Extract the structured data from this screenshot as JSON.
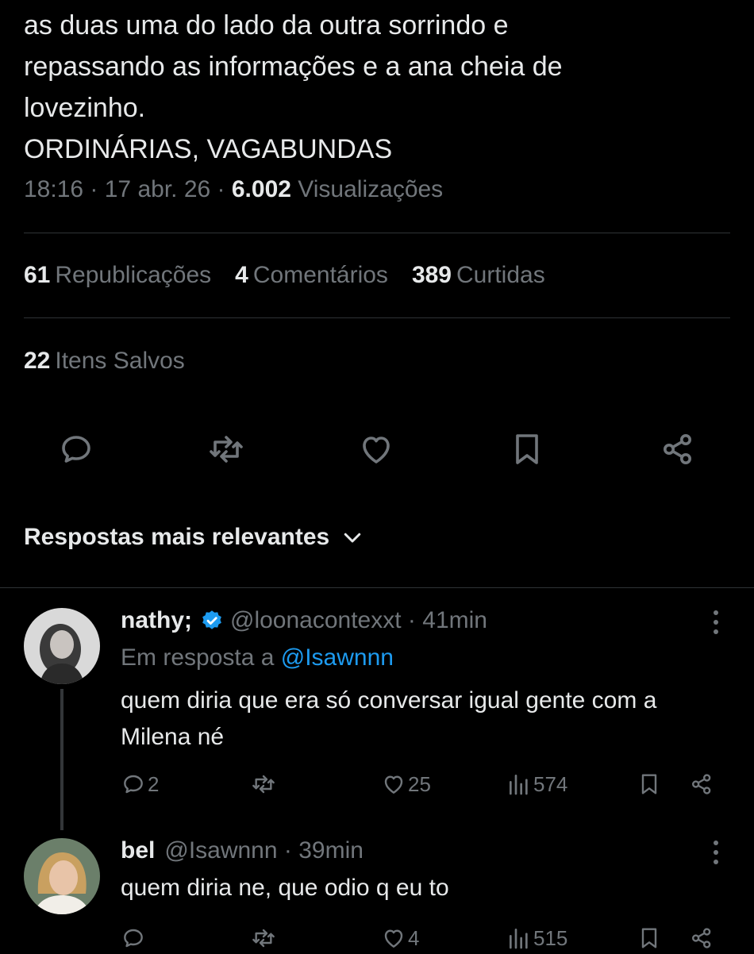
{
  "tweet": {
    "lines": [
      "as duas uma do lado da outra sorrindo e",
      "repassando as informações e a ana cheia de",
      "lovezinho.",
      "ORDINÁRIAS, VAGABUNDAS"
    ],
    "time": "18:16",
    "date": "17 abr. 26",
    "views_count": "6.002",
    "views_label": "Visualizações"
  },
  "stats": {
    "reposts_count": "61",
    "reposts_label": "Republicações",
    "comments_count": "4",
    "comments_label": "Comentários",
    "likes_count": "389",
    "likes_label": "Curtidas",
    "saved_count": "22",
    "saved_label": "Itens Salvos"
  },
  "actions": [
    "reply-icon",
    "repost-icon",
    "like-icon",
    "bookmark-icon",
    "share-icon"
  ],
  "sort": {
    "label": "Respostas mais relevantes"
  },
  "replies": [
    {
      "name": "nathy;",
      "verified": true,
      "handle": "@loonacontexxt",
      "time": "41min",
      "in_reply_prefix": "Em resposta a",
      "in_reply_mention": "@Isawnnn",
      "lines": [
        "quem diria que era só conversar igual gente com a",
        "Milena né"
      ],
      "replies": "2",
      "reposts": "",
      "likes": "25",
      "views": "574"
    },
    {
      "name": "bel",
      "verified": false,
      "handle": "@Isawnnn",
      "time": "39min",
      "lines": [
        "quem diria ne, que odio q eu to"
      ],
      "replies": "",
      "reposts": "",
      "likes": "4",
      "views": "515"
    }
  ],
  "colors": {
    "background": "#000000",
    "text": "#e7e9ea",
    "muted": "#71767b",
    "accent": "#1d9bf0",
    "divider": "#2f3336"
  }
}
